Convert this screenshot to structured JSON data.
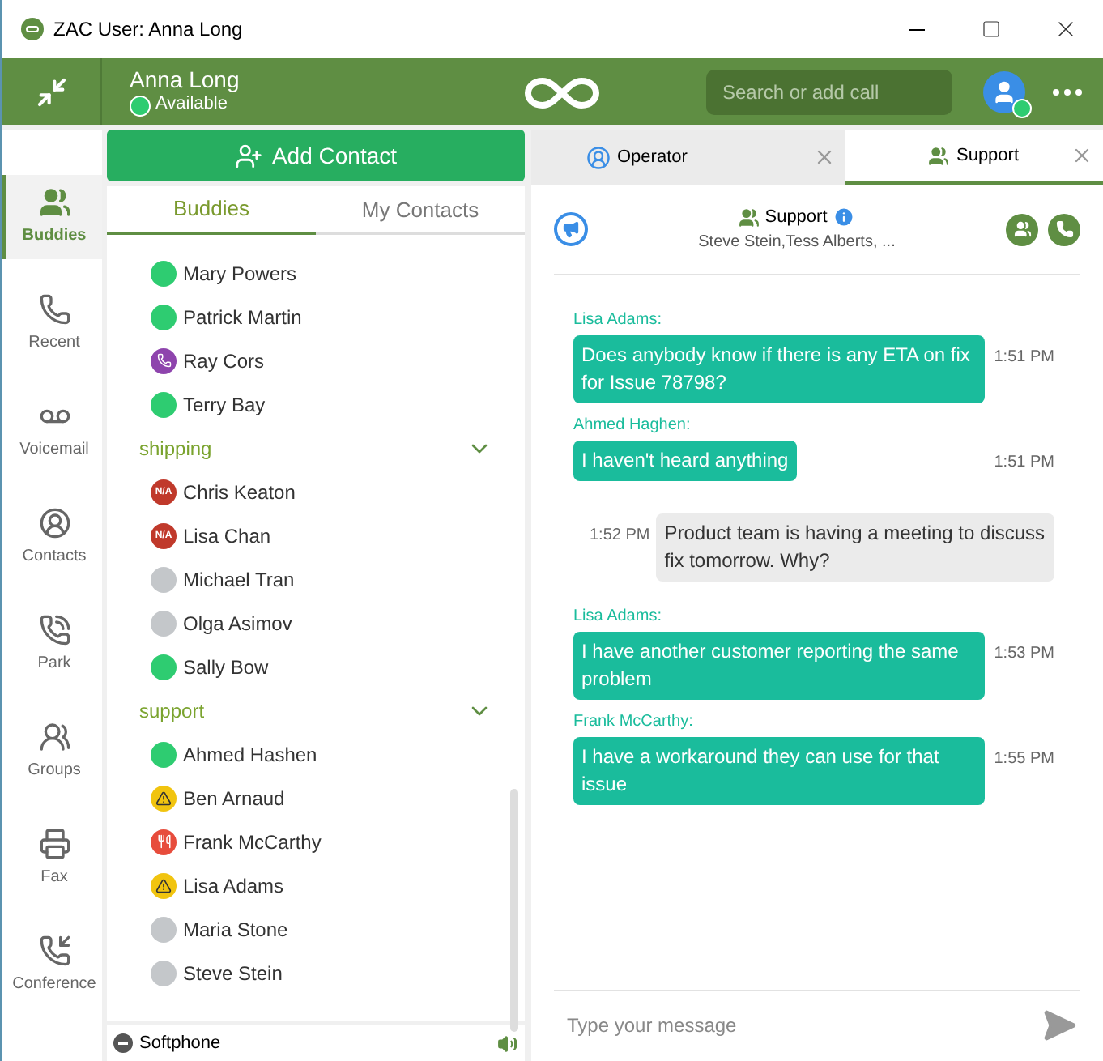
{
  "window": {
    "title": "ZAC User: Anna Long"
  },
  "header": {
    "user_name": "Anna Long",
    "status": "Available",
    "search": {
      "placeholder": "Search or add call"
    }
  },
  "nav": [
    {
      "label": "Buddies",
      "selected": true
    },
    {
      "label": "Recent",
      "selected": false
    },
    {
      "label": "Voicemail",
      "selected": false
    },
    {
      "label": "Contacts",
      "selected": false
    },
    {
      "label": "Park",
      "selected": false
    },
    {
      "label": "Groups",
      "selected": false
    },
    {
      "label": "Fax",
      "selected": false
    },
    {
      "label": "Conference",
      "selected": false
    }
  ],
  "add_contact_button": "Add Contact",
  "contact_tabs": [
    {
      "label": "Buddies",
      "selected": true
    },
    {
      "label": "My Contacts",
      "selected": false
    }
  ],
  "contact_list": [
    {
      "kind": "available",
      "name": "Mary Powers"
    },
    {
      "kind": "available",
      "name": "Patrick Martin"
    },
    {
      "kind": "calling",
      "name": "Ray Cors"
    },
    {
      "kind": "available",
      "name": "Terry Bay"
    },
    {
      "kind": "group",
      "name": "shipping",
      "expanded": true
    },
    {
      "kind": "unavailable",
      "name": "Chris Keaton",
      "badge": "N/A"
    },
    {
      "kind": "unavailable",
      "name": "Lisa Chan",
      "badge": "N/A"
    },
    {
      "kind": "offline",
      "name": "Michael Tran"
    },
    {
      "kind": "offline",
      "name": "Olga Asimov"
    },
    {
      "kind": "available",
      "name": "Sally Bow"
    },
    {
      "kind": "group",
      "name": "support",
      "expanded": true
    },
    {
      "kind": "available",
      "name": "Ahmed Hashen"
    },
    {
      "kind": "away",
      "name": "Ben Arnaud"
    },
    {
      "kind": "lunch",
      "name": "Frank McCarthy"
    },
    {
      "kind": "away",
      "name": "Lisa Adams"
    },
    {
      "kind": "offline",
      "name": "Maria Stone"
    },
    {
      "kind": "offline",
      "name": "Steve Stein"
    }
  ],
  "softphone": {
    "label": "Softphone"
  },
  "chat_tabs": [
    {
      "label": "Operator",
      "kind": "person",
      "selected": false
    },
    {
      "label": "Support",
      "kind": "group",
      "selected": true
    }
  ],
  "chat_header": {
    "title": "Support",
    "members": "Steve Stein,Tess Alberts, ..."
  },
  "messages": [
    {
      "kind": "incoming",
      "sender": "Lisa Adams:",
      "text": "Does anybody know if there is any ETA on fix for Issue 78798?",
      "time": "1:51 PM"
    },
    {
      "kind": "incoming",
      "sender": "Ahmed Haghen:",
      "text": "I haven't heard anything",
      "time": "1:51 PM"
    },
    {
      "kind": "outgoing",
      "text": "Product team is having a meeting to discuss fix tomorrow. Why?",
      "time": "1:52 PM"
    },
    {
      "kind": "incoming",
      "sender": "Lisa Adams:",
      "text": "I have another customer reporting the same problem",
      "time": "1:53 PM"
    },
    {
      "kind": "incoming",
      "sender": "Frank McCarthy:",
      "text": "I have a workaround they can use for that issue",
      "time": "1:55 PM"
    }
  ],
  "composer": {
    "placeholder": "Type your message"
  }
}
